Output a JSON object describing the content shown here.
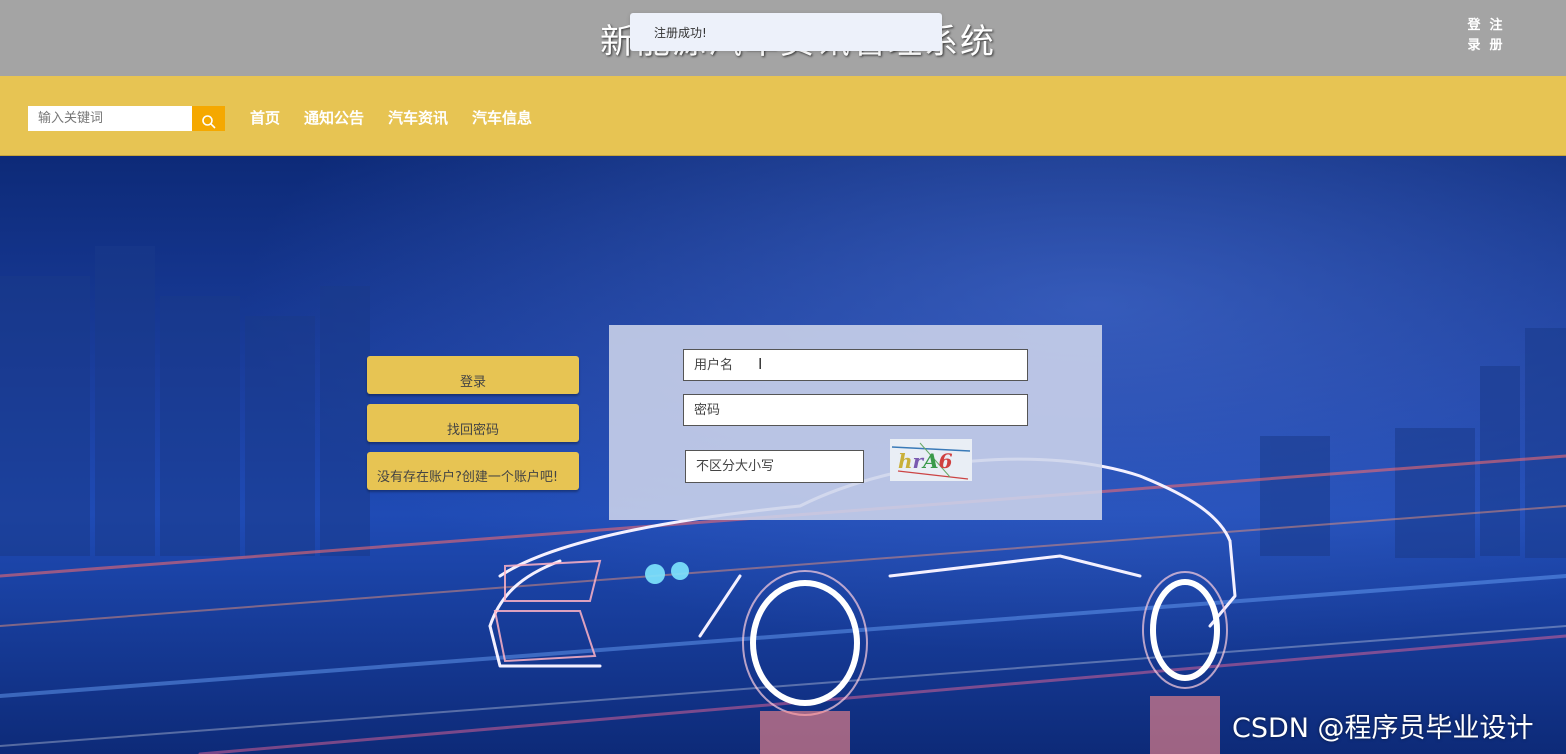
{
  "header": {
    "title": "新能源汽车资讯管理系统",
    "auth_links": [
      "登录",
      "注册"
    ]
  },
  "toast": {
    "message": "注册成功!"
  },
  "navbar": {
    "search_placeholder": "输入关键词",
    "search_icon": "search-icon",
    "links": [
      "首页",
      "通知公告",
      "汽车资讯",
      "汽车信息"
    ]
  },
  "sidebar": {
    "login_label": "登录",
    "forgot_label": "找回密码",
    "register_label": "没有存在账户?创建一个账户吧!"
  },
  "login_form": {
    "username_placeholder": "用户名",
    "password_placeholder": "密码",
    "captcha_placeholder": "不区分大小写",
    "captcha_text": "hrA6"
  },
  "watermark": "CSDN @程序员毕业设计",
  "colors": {
    "header_bg": "#a4a4a4",
    "nav_bg": "#e7c453",
    "search_button": "#f5a800",
    "hero_blue": "#1f4bb5"
  }
}
